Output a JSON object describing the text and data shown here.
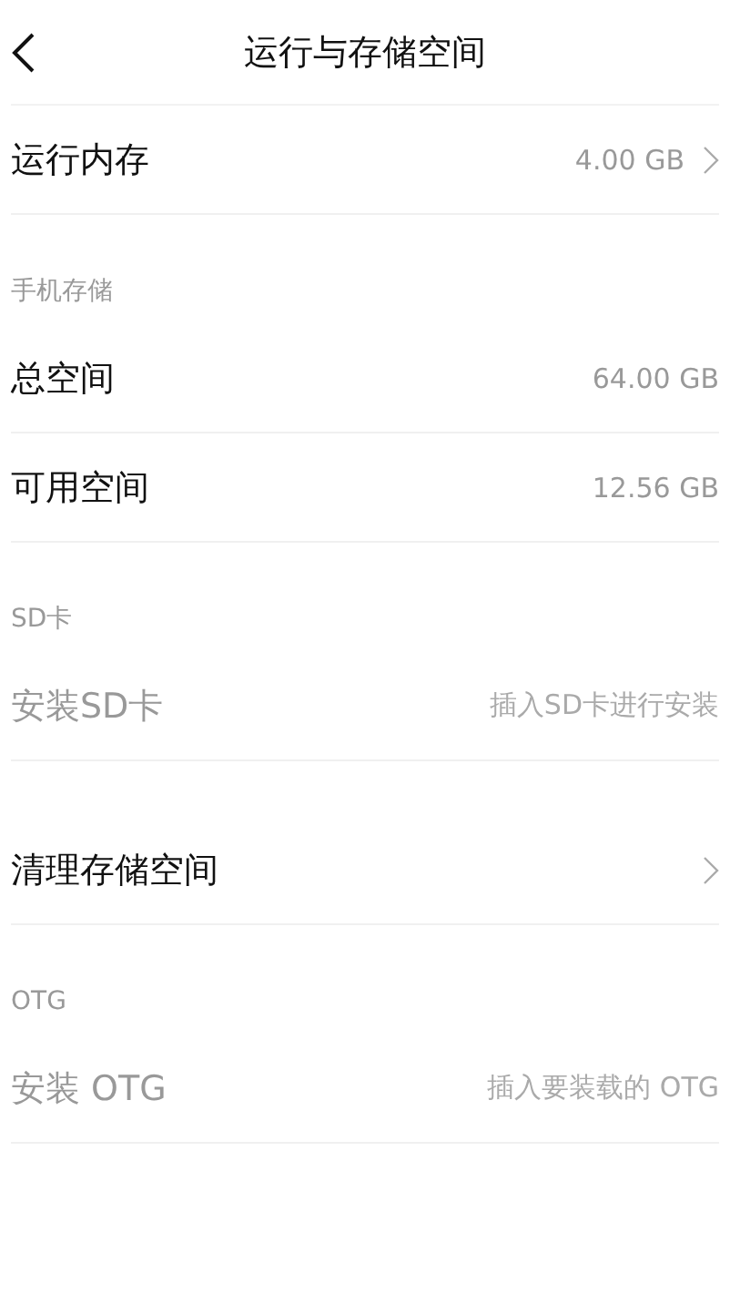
{
  "header": {
    "title": "运行与存储空间"
  },
  "groups": [
    {
      "rows": [
        {
          "label": "运行内存",
          "value": "4.00 GB",
          "chevron": true,
          "disabled": false
        }
      ]
    },
    {
      "title": "手机存储",
      "rows": [
        {
          "label": "总空间",
          "value": "64.00 GB",
          "chevron": false,
          "disabled": false
        },
        {
          "label": "可用空间",
          "value": "12.56 GB",
          "chevron": false,
          "disabled": false
        }
      ]
    },
    {
      "title": "SD卡",
      "rows": [
        {
          "label": "安装SD卡",
          "value": "插入SD卡进行安装",
          "chevron": false,
          "disabled": true
        }
      ]
    },
    {
      "rows": [
        {
          "label": "清理存储空间",
          "chevron": true,
          "disabled": false
        }
      ]
    },
    {
      "title": "OTG",
      "rows": [
        {
          "label": "安装 OTG",
          "value": "插入要装载的 OTG",
          "chevron": false,
          "disabled": true
        }
      ]
    }
  ]
}
